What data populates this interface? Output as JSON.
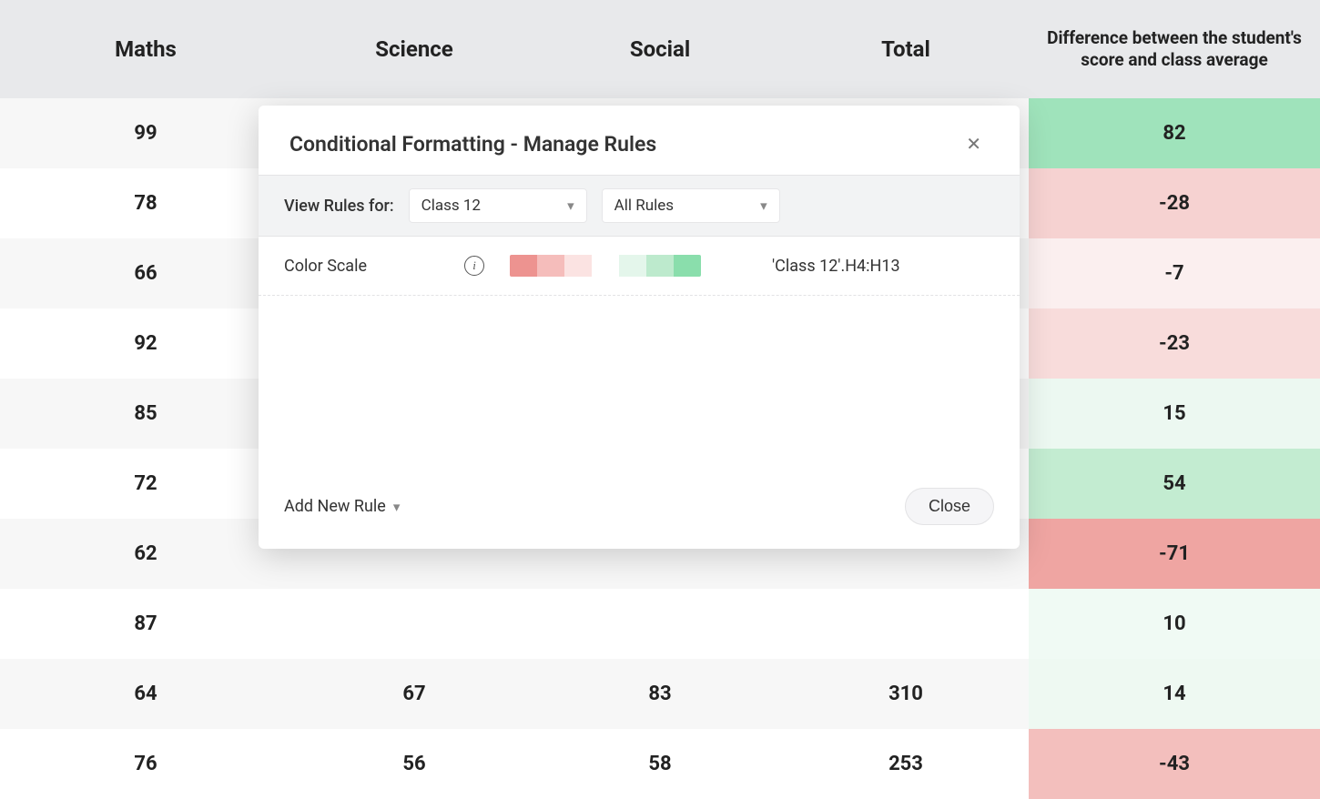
{
  "table": {
    "headers": {
      "maths": "Maths",
      "science": "Science",
      "social": "Social",
      "total": "Total",
      "diff": "Difference between the student's score and class average"
    },
    "rows": [
      {
        "maths": "99",
        "science": "",
        "social": "",
        "total": "",
        "diff": "82",
        "diff_color": "#9fe3bb"
      },
      {
        "maths": "78",
        "science": "",
        "social": "",
        "total": "",
        "diff": "-28",
        "diff_color": "#f6d2d1"
      },
      {
        "maths": "66",
        "science": "",
        "social": "",
        "total": "",
        "diff": "-7",
        "diff_color": "#fbefef"
      },
      {
        "maths": "92",
        "science": "",
        "social": "",
        "total": "",
        "diff": "-23",
        "diff_color": "#f8dcdb"
      },
      {
        "maths": "85",
        "science": "",
        "social": "",
        "total": "",
        "diff": "15",
        "diff_color": "#ecf8f1"
      },
      {
        "maths": "72",
        "science": "",
        "social": "",
        "total": "",
        "diff": "54",
        "diff_color": "#c3ecd1"
      },
      {
        "maths": "62",
        "science": "",
        "social": "",
        "total": "",
        "diff": "-71",
        "diff_color": "#efa5a2"
      },
      {
        "maths": "87",
        "science": "",
        "social": "",
        "total": "",
        "diff": "10",
        "diff_color": "#f0faf4"
      },
      {
        "maths": "64",
        "science": "67",
        "social": "83",
        "total": "310",
        "diff": "14",
        "diff_color": "#eef9f2"
      },
      {
        "maths": "76",
        "science": "56",
        "social": "58",
        "total": "253",
        "diff": "-43",
        "diff_color": "#f3bfbd"
      }
    ]
  },
  "modal": {
    "title": "Conditional Formatting - Manage Rules",
    "view_rules_label": "View Rules for:",
    "sheet_select": "Class 12",
    "rules_select": "All Rules",
    "rule_name": "Color Scale",
    "rule_range": "'Class 12'.H4:H13",
    "add_new_rule_label": "Add New Rule",
    "close_label": "Close",
    "scale_colors": [
      "#ed9390",
      "#f5bdbb",
      "#fbe3e2",
      "#ffffff",
      "#e4f6eb",
      "#bdeacd",
      "#8adeac"
    ]
  }
}
